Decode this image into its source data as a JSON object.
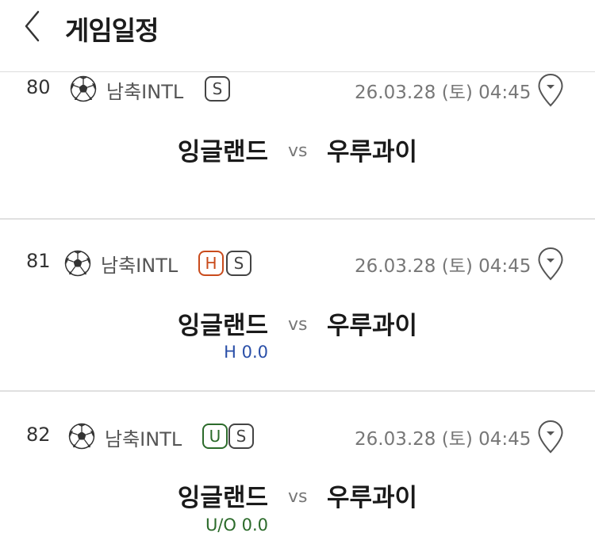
{
  "header": {
    "title": "게임일정"
  },
  "games": [
    {
      "number": "80",
      "league": "남축INTL",
      "badges": [
        "S"
      ],
      "datetime": "26.03.28 (토) 04:45",
      "home": "잉글랜드",
      "vs": "vs",
      "away": "우루과이",
      "sub": ""
    },
    {
      "number": "81",
      "league": "남축INTL",
      "badges": [
        "H",
        "S"
      ],
      "datetime": "26.03.28 (토) 04:45",
      "home": "잉글랜드",
      "vs": "vs",
      "away": "우루과이",
      "sub": "H 0.0"
    },
    {
      "number": "82",
      "league": "남축INTL",
      "badges": [
        "U",
        "S"
      ],
      "datetime": "26.03.28 (토) 04:45",
      "home": "잉글랜드",
      "vs": "vs",
      "away": "우루과이",
      "sub": "U/O 0.0"
    }
  ],
  "colors": {
    "handicap": "#c94b1c",
    "under_over": "#2c6b2b",
    "handicap_value": "#2a4fa8"
  },
  "icons": {
    "back": "chevron-left-icon",
    "sport": "soccer-ball-icon",
    "pin": "location-pin-icon"
  }
}
